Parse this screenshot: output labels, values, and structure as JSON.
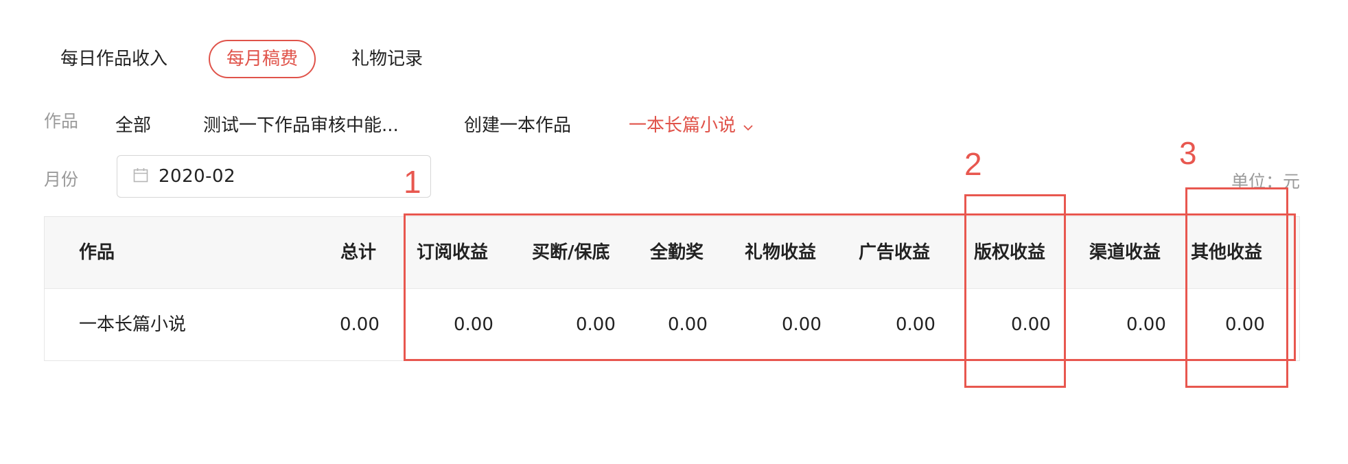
{
  "tabs": [
    {
      "label": "每日作品收入",
      "active": false
    },
    {
      "label": "每月稿费",
      "active": true
    },
    {
      "label": "礼物记录",
      "active": false
    }
  ],
  "filters": {
    "work_label": "作品",
    "works": [
      "全部",
      "测试一下作品审核中能...",
      "创建一本作品",
      "一本长篇小说"
    ],
    "selected_work": "一本长篇小说",
    "month_label": "月份",
    "month_value": "2020-02"
  },
  "unit_text": "单位：元",
  "table": {
    "headers": [
      "作品",
      "总计",
      "订阅收益",
      "买断/保底",
      "全勤奖",
      "礼物收益",
      "广告收益",
      "版权收益",
      "渠道收益",
      "其他收益"
    ],
    "rows": [
      [
        "一本长篇小说",
        "0.00",
        "0.00",
        "0.00",
        "0.00",
        "0.00",
        "0.00",
        "0.00",
        "0.00",
        "0.00"
      ]
    ]
  },
  "annotations": {
    "labels": [
      "1",
      "2",
      "3"
    ],
    "color": "#e8574f"
  },
  "colors": {
    "accent": "#e0534a",
    "muted": "#9a9a9a",
    "header_bg": "#f7f7f7"
  }
}
